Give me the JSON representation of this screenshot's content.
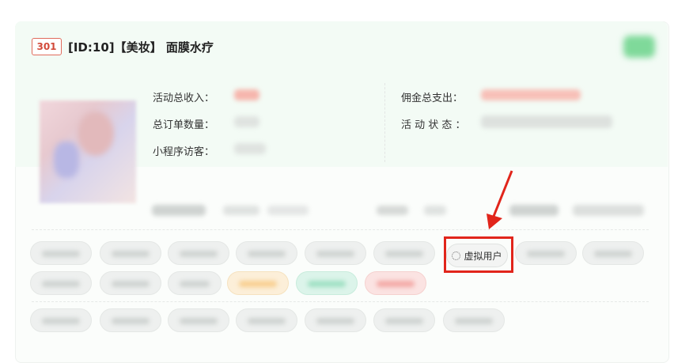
{
  "header": {
    "id_badge": "301",
    "title": "[ID:10]【美妆】 面膜水疗"
  },
  "stats": {
    "income_label": "活动总收入：",
    "orders_label": "总订单数量：",
    "visitors_label": "小程序访客：",
    "commission_label": "佣金总支出：",
    "status_label": "活 动 状 态 ："
  },
  "actions": {
    "virtual_user_label": "虚拟用户"
  },
  "colors": {
    "highlight_box": "#e1251b",
    "badge": "#d24a3a",
    "header_bg": "#f3fbf5"
  }
}
